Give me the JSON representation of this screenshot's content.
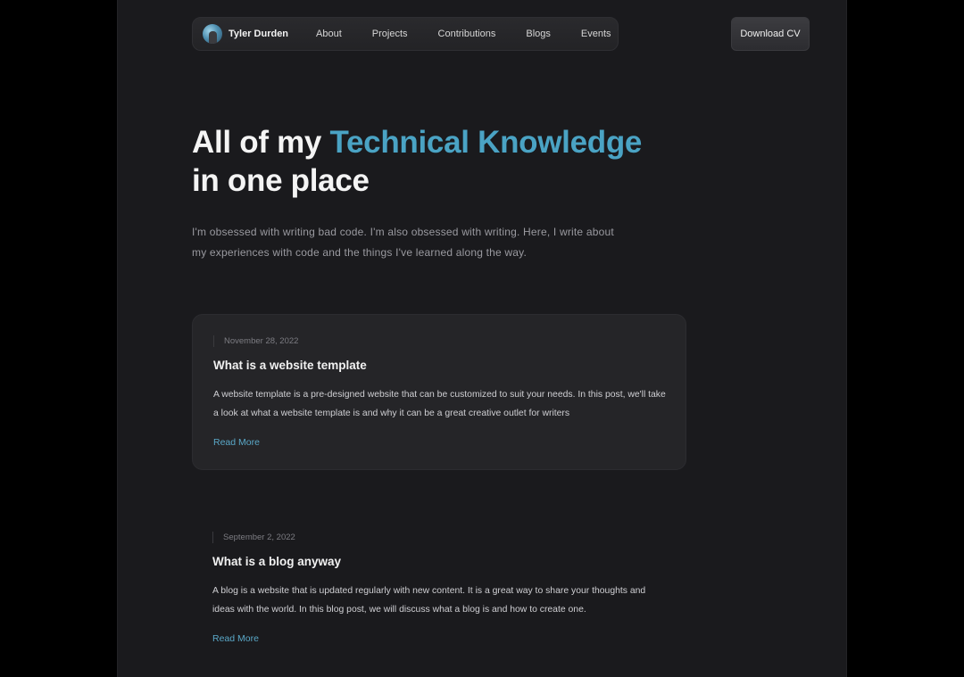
{
  "nav": {
    "brand_name": "Tyler Durden",
    "avatar_icon": "avatar-photo",
    "links": [
      {
        "label": "About"
      },
      {
        "label": "Projects"
      },
      {
        "label": "Contributions"
      },
      {
        "label": "Blogs"
      },
      {
        "label": "Events"
      }
    ],
    "cv_button": "Download CV"
  },
  "hero": {
    "title_part1": "All of my ",
    "title_accent": "Technical Knowledge",
    "title_part2": "in one place",
    "subtitle": "I'm obsessed with writing bad code. I'm also obsessed with writing. Here, I write about my experiences with code and the things I've learned along the way."
  },
  "posts": [
    {
      "date": "November 28, 2022",
      "title": "What is a website template",
      "excerpt": "A website template is a pre-designed website that can be customized to suit your needs. In this post, we'll take a look at what a website template is and why it can be a great creative outlet for writers",
      "cta": "Read More"
    },
    {
      "date": "September 2, 2022",
      "title": "What is a blog anyway",
      "excerpt": "A blog is a website that is updated regularly with new content. It is a great way to share your thoughts and ideas with the world. In this blog post, we will discuss what a blog is and how to create one.",
      "cta": "Read More"
    }
  ],
  "colors": {
    "page_background": "#1a1a1d",
    "outer_background": "#000000",
    "accent": "#4aa3c4",
    "link": "#5aa8c8",
    "card_background": "#252528"
  }
}
